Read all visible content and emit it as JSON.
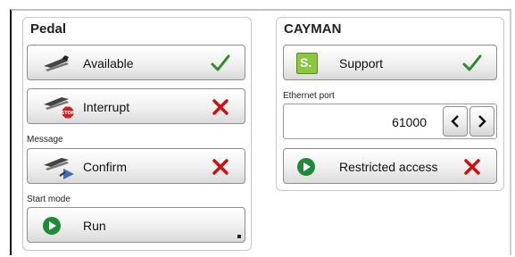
{
  "pedal": {
    "title": "Pedal",
    "available_label": "Available",
    "interrupt_label": "Interrupt",
    "message_label": "Message",
    "confirm_label": "Confirm",
    "start_mode_label": "Start mode",
    "run_label": "Run",
    "stop_badge": "STOP"
  },
  "cayman": {
    "title": "CAYMAN",
    "support_label": "Support",
    "support_badge": "S.",
    "ethernet_port_label": "Ethernet port",
    "ethernet_port_value": "61000",
    "restricted_label": "Restricted access"
  },
  "colors": {
    "check_green": "#2e8b2e",
    "cross_red": "#cc1111",
    "support_green": "#8cc63f",
    "run_green": "#1f8a3a"
  }
}
